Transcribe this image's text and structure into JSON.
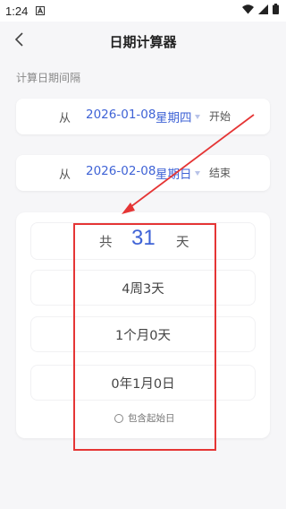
{
  "status_bar": {
    "time": "1:24",
    "notification_icon": "a-notification-icon",
    "wifi_icon": "wifi-icon",
    "signal_icon": "signal-icon",
    "battery_icon": "battery-icon"
  },
  "header": {
    "back_icon": "chevron-left-icon",
    "title": "日期计算器"
  },
  "section": {
    "label": "计算日期间隔"
  },
  "start_row": {
    "from_label": "从",
    "date": "2026-01-08",
    "weekday": "星期四",
    "tag": "开始"
  },
  "end_row": {
    "from_label": "从",
    "date": "2026-02-08",
    "weekday": "星期日",
    "tag": "结束"
  },
  "result": {
    "total_prefix": "共",
    "total_days": "31",
    "total_suffix": "天",
    "weeks_days": "4周3天",
    "months_days": "1个月0天",
    "years_months_days": "0年1月0日",
    "include_start_label": "包含起始日",
    "include_start_checked": false
  },
  "colors": {
    "accent": "#3f63d6",
    "annotation": "#e53535",
    "background": "#f6f6f8"
  }
}
